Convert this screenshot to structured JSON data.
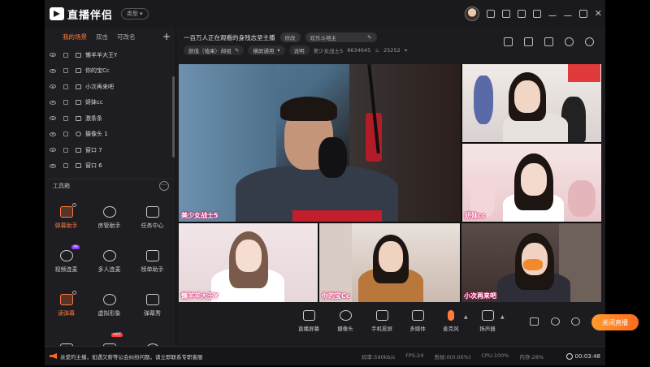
{
  "app": {
    "name": "直播伴侣",
    "type_label": "类型"
  },
  "scene_tabs": [
    {
      "label": "我的场景",
      "active": true
    },
    {
      "label": "双击",
      "active": false
    },
    {
      "label": "可改名",
      "active": false
    }
  ],
  "sources": [
    {
      "label": "懒羊羊大王Y",
      "icon": "image-icon"
    },
    {
      "label": "你的宝Cc",
      "icon": "image-icon"
    },
    {
      "label": "小次再来吧",
      "icon": "image-icon"
    },
    {
      "label": "妍妹cc",
      "icon": "image-icon"
    },
    {
      "label": "激条条",
      "icon": "image-icon"
    },
    {
      "label": "摄像头 1",
      "icon": "camera-icon"
    },
    {
      "label": "窗口 7",
      "icon": "window-icon"
    },
    {
      "label": "窗口 6",
      "icon": "window-icon"
    }
  ],
  "tools_label": "工具箱",
  "tools": [
    {
      "label": "弹幕助手",
      "active": true,
      "badge": "",
      "icon": "danmaku-icon"
    },
    {
      "label": "房管助手",
      "active": false,
      "badge": "",
      "icon": "admin-icon"
    },
    {
      "label": "任务中心",
      "active": false,
      "badge": "",
      "icon": "task-icon"
    },
    {
      "label": "视频连麦",
      "active": false,
      "badge": "PK",
      "icon": "video-link-icon"
    },
    {
      "label": "多人连麦",
      "active": false,
      "badge": "",
      "icon": "multi-link-icon"
    },
    {
      "label": "榜单助手",
      "active": false,
      "badge": "",
      "icon": "ranking-icon"
    },
    {
      "label": "读弹幕",
      "active": true,
      "badge": "",
      "icon": "read-danmaku-icon"
    },
    {
      "label": "虚拟形象",
      "active": false,
      "badge": "",
      "icon": "avatar-icon"
    },
    {
      "label": "弹幕秀",
      "active": false,
      "badge": "",
      "icon": "danmaku-show-icon"
    },
    {
      "label": "",
      "active": false,
      "badge": "",
      "icon": "gift-icon"
    },
    {
      "label": "",
      "active": false,
      "badge": "HOT",
      "icon": "game-icon"
    },
    {
      "label": "",
      "active": false,
      "badge": "",
      "icon": "fire-icon"
    }
  ],
  "stream": {
    "title": "一百万人正在观看的身残志坚主播",
    "edit_label": "修改",
    "room_pill": "欢乐斗地主",
    "category_pill": "颜值（嗑果）· 邮组",
    "mode_pill": "横屏通用",
    "desc_label": "说明",
    "streamer_name": "美少女战士5",
    "id_value": "8634645",
    "fans_value": "25252"
  },
  "video_cells": [
    {
      "label": "美少女战士5"
    },
    {
      "label": ""
    },
    {
      "label": "妍妹cc"
    },
    {
      "label": "懒羊羊大王Y"
    },
    {
      "label": "你的宝Cc"
    },
    {
      "label": "小次再来吧"
    }
  ],
  "bottom_tools": [
    {
      "label": "直播屏幕",
      "icon": "screen-icon"
    },
    {
      "label": "摄像头",
      "icon": "camera-icon"
    },
    {
      "label": "手机投屏",
      "icon": "phone-cast-icon"
    },
    {
      "label": "多媒体",
      "icon": "media-icon"
    },
    {
      "label": "麦克风",
      "icon": "microphone-icon"
    },
    {
      "label": "扬声器",
      "icon": "speaker-icon"
    }
  ],
  "start_label": "关闭直播",
  "status": {
    "notice": "亲爱的主播，如遇欠薪等公会纠纷问题，请立即联系专职客服",
    "bitrate": "码率:590kb/s",
    "fps": "FPS:24",
    "dropped": "丢帧:0(0.00%)",
    "cpu": "CPU:100%",
    "memory": "内存:28%",
    "time": "00:03:48"
  },
  "colors": {
    "accent": "#ff7a3d",
    "bg": "#1c1c20",
    "label_glow": "#d9005b"
  }
}
